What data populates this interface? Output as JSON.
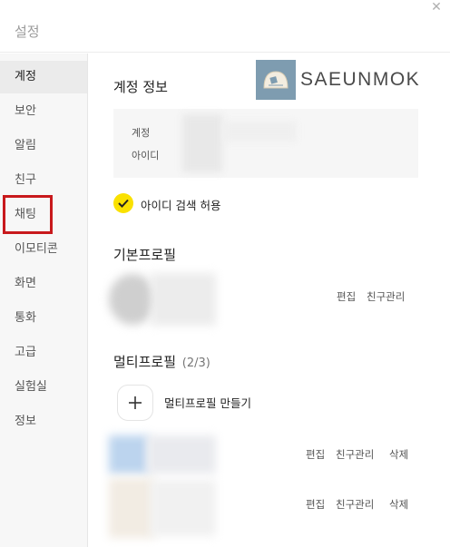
{
  "window": {
    "title": "설정"
  },
  "sidebar": {
    "items": [
      {
        "label": "계정"
      },
      {
        "label": "보안"
      },
      {
        "label": "알림"
      },
      {
        "label": "친구"
      },
      {
        "label": "채팅"
      },
      {
        "label": "이모티콘"
      },
      {
        "label": "화면"
      },
      {
        "label": "통화"
      },
      {
        "label": "고급"
      },
      {
        "label": "실험실"
      },
      {
        "label": "정보"
      }
    ],
    "active_index": 0,
    "highlighted_index": 4
  },
  "logo": {
    "text": "SAEUNMOK"
  },
  "account_info": {
    "heading": "계정 정보",
    "account_label": "계정",
    "id_label": "아이디",
    "allow_id_search": {
      "label": "아이디 검색 허용",
      "checked": true
    }
  },
  "basic_profile": {
    "heading": "기본프로필",
    "edit_label": "편집",
    "manage_friends_label": "친구관리"
  },
  "multi_profile": {
    "heading": "멀티프로필",
    "count": "(2/3)",
    "create_label": "멀티프로필 만들기",
    "profiles": [
      {
        "edit_label": "편집",
        "manage_friends_label": "친구관리",
        "delete_label": "삭제"
      },
      {
        "edit_label": "편집",
        "manage_friends_label": "친구관리",
        "delete_label": "삭제"
      }
    ]
  },
  "colors": {
    "checkbox_accent": "#fae100",
    "highlight_border": "#c8191c",
    "sidebar_bg": "#f7f7f7",
    "logo_badge": "#7e9cb0"
  }
}
